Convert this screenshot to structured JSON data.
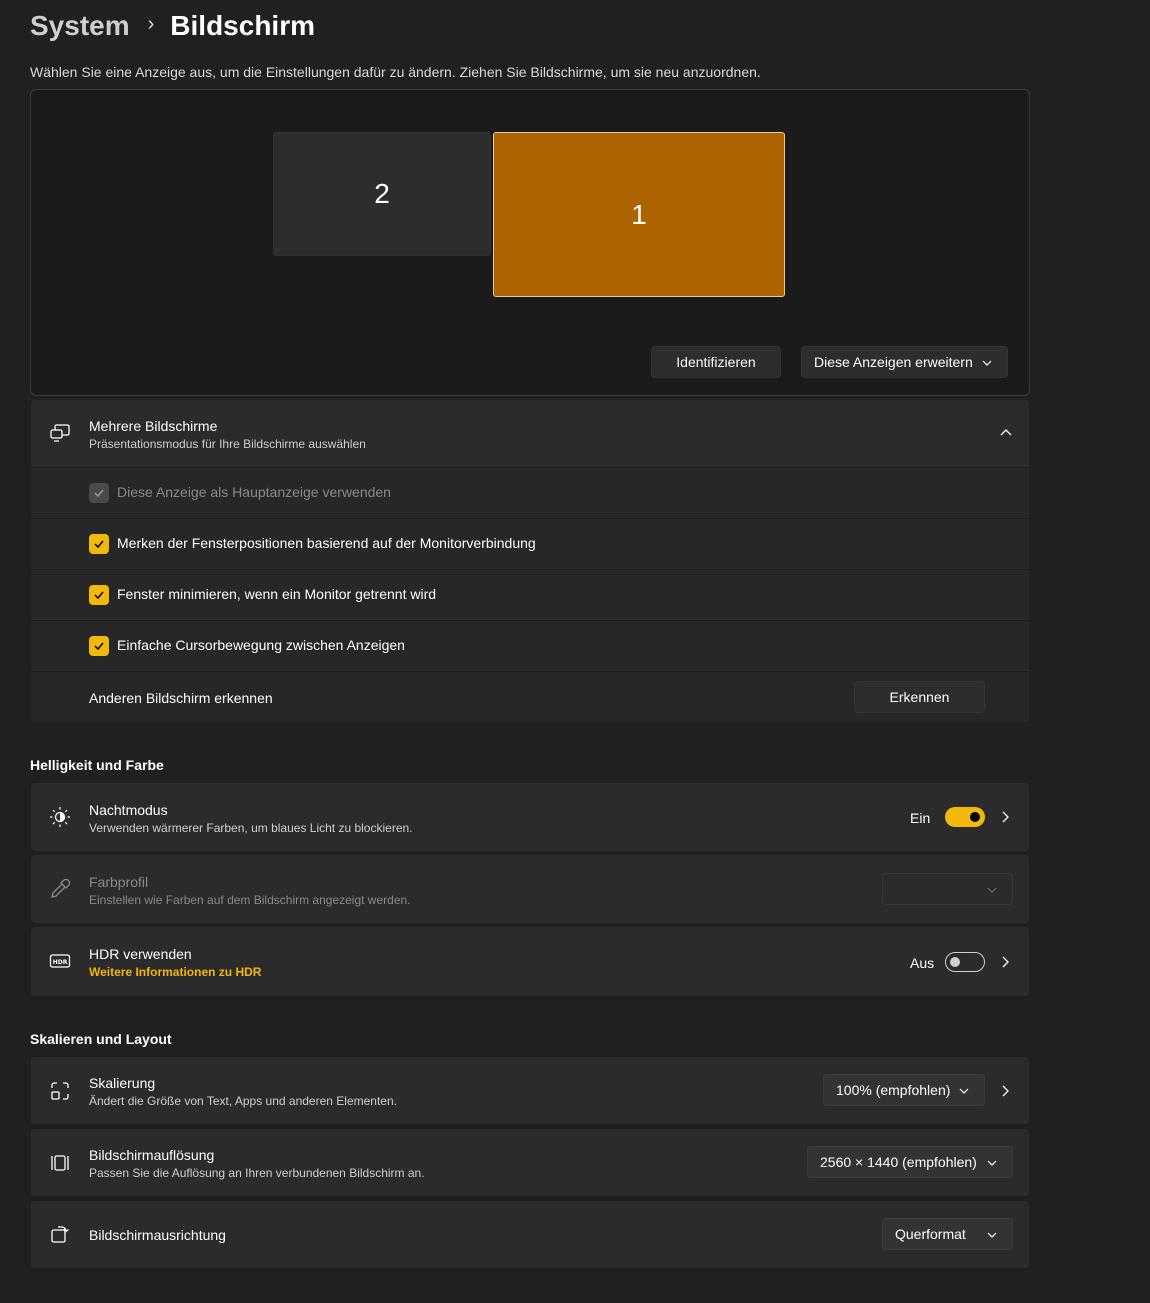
{
  "breadcrumb": {
    "parent": "System",
    "separator": "›",
    "current": "Bildschirm"
  },
  "instruction": "Wählen Sie eine Anzeige aus, um die Einstellungen dafür zu ändern. Ziehen Sie Bildschirme, um sie neu anzuordnen.",
  "arrangement": {
    "monitors": [
      {
        "label": "2",
        "selected": false
      },
      {
        "label": "1",
        "selected": true
      }
    ],
    "identify_label": "Identifizieren",
    "extend_label": "Diese Anzeigen erweitern",
    "selected_color": "#ad6400"
  },
  "multiple_displays": {
    "title": "Mehrere Bildschirme",
    "subtitle": "Präsentationsmodus für Ihre Bildschirme auswählen",
    "expanded": true,
    "options": [
      {
        "label": "Diese Anzeige als Hauptanzeige verwenden",
        "checked": true,
        "disabled": true
      },
      {
        "label": "Merken der Fensterpositionen basierend auf der Monitorverbindung",
        "checked": true,
        "disabled": false
      },
      {
        "label": "Fenster minimieren, wenn ein Monitor getrennt wird",
        "checked": true,
        "disabled": false
      },
      {
        "label": "Einfache Cursorbewegung zwischen Anzeigen",
        "checked": true,
        "disabled": false
      }
    ],
    "detect": {
      "label": "Anderen Bildschirm erkennen",
      "button": "Erkennen"
    }
  },
  "brightness_section": {
    "title": "Helligkeit und Farbe",
    "night_mode": {
      "title": "Nachtmodus",
      "subtitle": "Verwenden wärmerer Farben, um blaues Licht zu blockieren.",
      "state_label": "Ein",
      "on": true
    },
    "color_profile": {
      "title": "Farbprofil",
      "subtitle": "Einstellen wie Farben auf dem Bildschirm angezeigt werden.",
      "value": "",
      "disabled": true
    },
    "hdr": {
      "title": "HDR verwenden",
      "link": "Weitere Informationen zu HDR",
      "state_label": "Aus",
      "on": false
    }
  },
  "scale_section": {
    "title": "Skalieren und Layout",
    "scaling": {
      "title": "Skalierung",
      "subtitle": "Ändert die Größe von Text, Apps und anderen Elementen.",
      "value": "100% (empfohlen)"
    },
    "resolution": {
      "title": "Bildschirmauflösung",
      "subtitle": "Passen Sie die Auflösung an Ihren verbundenen Bildschirm an.",
      "value": "2560 × 1440 (empfohlen)"
    },
    "orientation": {
      "title": "Bildschirmausrichtung",
      "value": "Querformat"
    }
  },
  "accent_color": "#f2b80a"
}
